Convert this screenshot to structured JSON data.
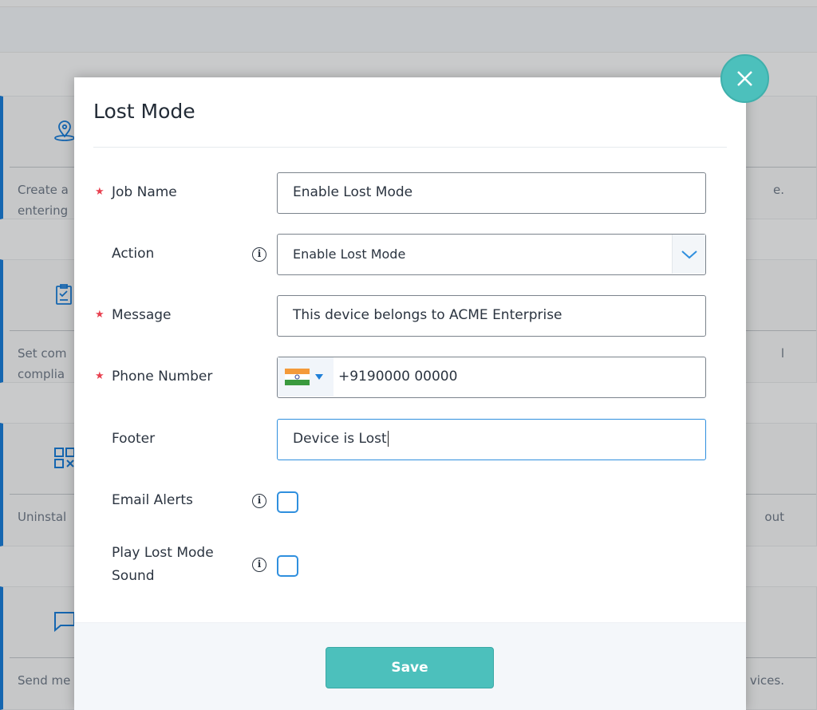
{
  "background": {
    "cards_left": [
      {
        "icon": "location-pin-icon",
        "lines": [
          "Create a",
          "entering"
        ]
      },
      {
        "icon": "clipboard-check-icon",
        "lines": [
          "Set com",
          "complia"
        ]
      },
      {
        "icon": "qr-code-icon",
        "lines": [
          "Uninstal",
          ""
        ]
      },
      {
        "icon": "chat-bubble-icon",
        "lines": [
          "Send me",
          ""
        ]
      }
    ],
    "cards_right": [
      {
        "lines": [
          "e.",
          ""
        ]
      },
      {
        "lines": [
          "l",
          ""
        ]
      },
      {
        "lines": [
          "out",
          ""
        ]
      },
      {
        "lines": [
          "vices.",
          ""
        ]
      }
    ]
  },
  "modal": {
    "title": "Lost Mode",
    "fields": {
      "job_name": {
        "label": "Job Name",
        "value": "Enable Lost Mode",
        "required": true
      },
      "action": {
        "label": "Action",
        "value": "Enable Lost Mode"
      },
      "message": {
        "label": "Message",
        "value": "This device belongs to ACME Enterprise",
        "required": true
      },
      "phone": {
        "label": "Phone Number",
        "value": "+9190000 00000",
        "country": "India",
        "required": true
      },
      "footer": {
        "label": "Footer",
        "value": "Device is Lost"
      },
      "email_alerts": {
        "label": "Email Alerts",
        "checked": false
      },
      "play_sound": {
        "label_line1": "Play Lost Mode",
        "label_line2": "Sound",
        "checked": false
      }
    },
    "required_mark": "★",
    "info_glyph": "i",
    "save_label": "Save"
  },
  "colors": {
    "accent": "#4cc0bc",
    "focus": "#2f8fde",
    "required": "#e8404f"
  }
}
